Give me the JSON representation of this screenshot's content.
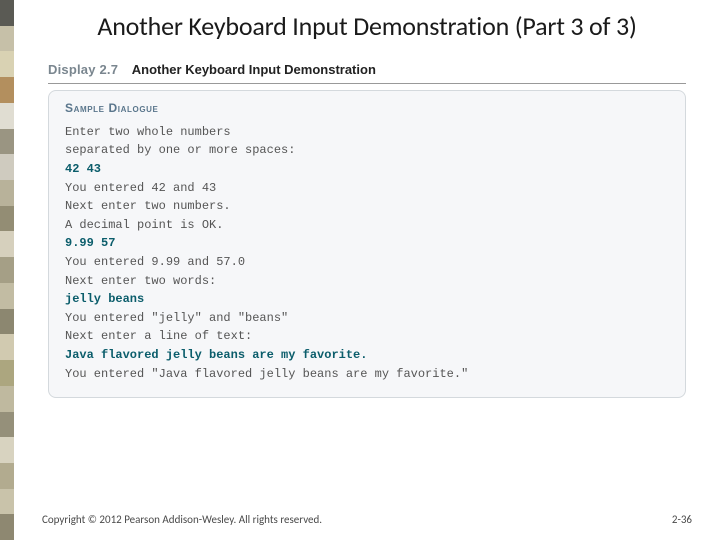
{
  "stripe_colors": [
    "#5a5a54",
    "#c6c0a8",
    "#d9d2b3",
    "#b38f5e",
    "#e0ddd2",
    "#9a9582",
    "#cfcbbf",
    "#b8b29a",
    "#938d74",
    "#d6d0bd",
    "#a59f86",
    "#c2bca3",
    "#8c8770",
    "#d1cab0",
    "#aca67f",
    "#bfb99f",
    "#95907a",
    "#d8d3c0",
    "#b2ab8f",
    "#c9c3aa",
    "#8e8871"
  ],
  "title": "Another Keyboard Input Demonstration (Part 3 of 3)",
  "display": {
    "label": "Display 2.7",
    "title": "Another Keyboard Input Demonstration"
  },
  "sample": {
    "label": "Sample Dialogue",
    "lines": [
      {
        "text": "Enter two whole numbers",
        "input": false
      },
      {
        "text": "separated by one or more spaces:",
        "input": false
      },
      {
        "text": "  42   43",
        "input": true
      },
      {
        "text": "You entered 42 and 43",
        "input": false
      },
      {
        "text": "Next enter two numbers.",
        "input": false
      },
      {
        "text": "A decimal point is OK.",
        "input": false
      },
      {
        "text": "  9.99  57",
        "input": true
      },
      {
        "text": "You entered 9.99 and 57.0",
        "input": false
      },
      {
        "text": "Next enter two words:",
        "input": false
      },
      {
        "text": "jelly beans",
        "input": true
      },
      {
        "text": "You entered \"jelly\" and \"beans\"",
        "input": false
      },
      {
        "text": "Next enter a line of text:",
        "input": false
      },
      {
        "text": "Java flavored jelly beans are my favorite.",
        "input": true
      },
      {
        "text": "You entered \"Java flavored jelly beans are my favorite.\"",
        "input": false
      }
    ]
  },
  "footer": {
    "copyright": "Copyright © 2012 Pearson Addison-Wesley. All rights reserved.",
    "page": "2-36"
  }
}
